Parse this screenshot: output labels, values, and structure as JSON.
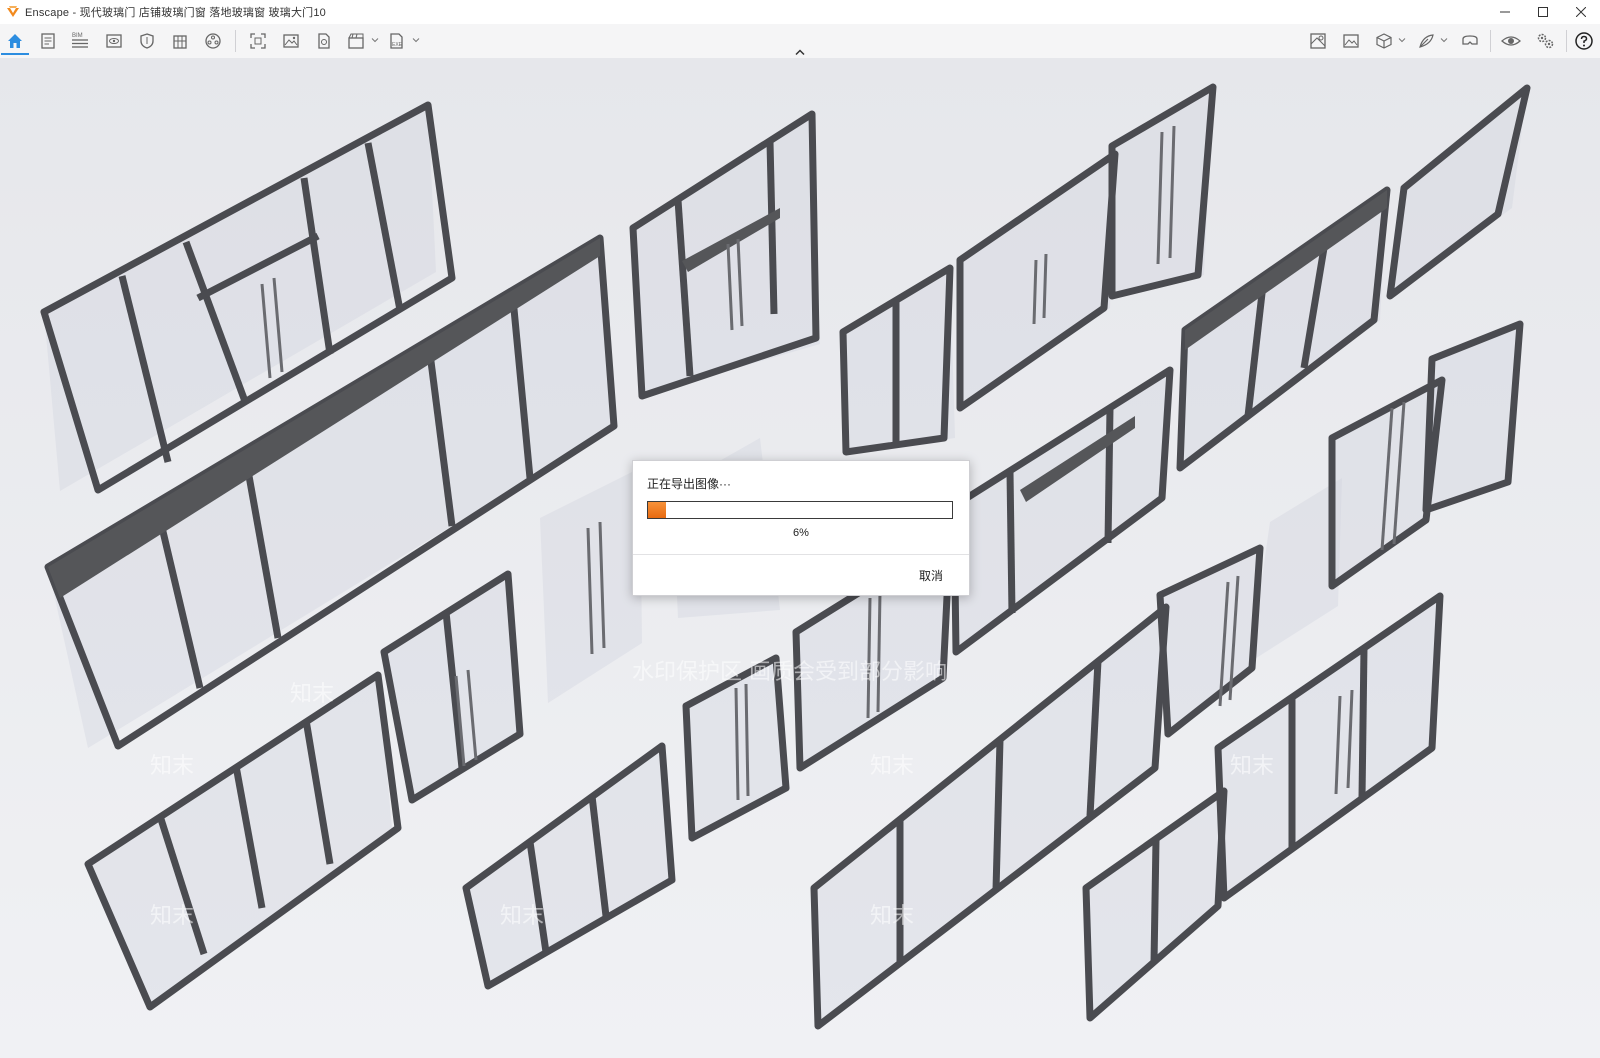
{
  "window": {
    "app_name": "Enscape",
    "title": "Enscape - 现代玻璃门 店铺玻璃门窗 落地玻璃窗 玻璃大门10",
    "controls": [
      "minimize-icon",
      "maximize-icon",
      "close-icon"
    ]
  },
  "toolbar": {
    "left_icons": [
      "home-icon",
      "document-icon",
      "bim-icon",
      "eye-panel-icon",
      "shield-view-icon",
      "building-icon",
      "asset-library-icon",
      "screenshot-icon",
      "image-icon",
      "batch-render-icon",
      "video-export-icon",
      "exe-export-icon"
    ],
    "bim_label": "BIM",
    "exe_label": "EXE",
    "right_icons": [
      "map-view-icon",
      "gallery-icon",
      "cube-view-icon",
      "feather-icon",
      "vr-headset-icon",
      "visibility-icon",
      "settings-icon",
      "help-icon"
    ],
    "active_tab": "home-icon",
    "accent_color": "#2c8de0"
  },
  "viewport": {
    "watermark_text": "水印保护区 画质会受到部分影响",
    "watermark_brand": "知末"
  },
  "dialog": {
    "title": "正在导出图像···",
    "progress_percent": 6,
    "progress_label": "6%",
    "cancel_label": "取消",
    "progress_color": "#f07d1e"
  }
}
